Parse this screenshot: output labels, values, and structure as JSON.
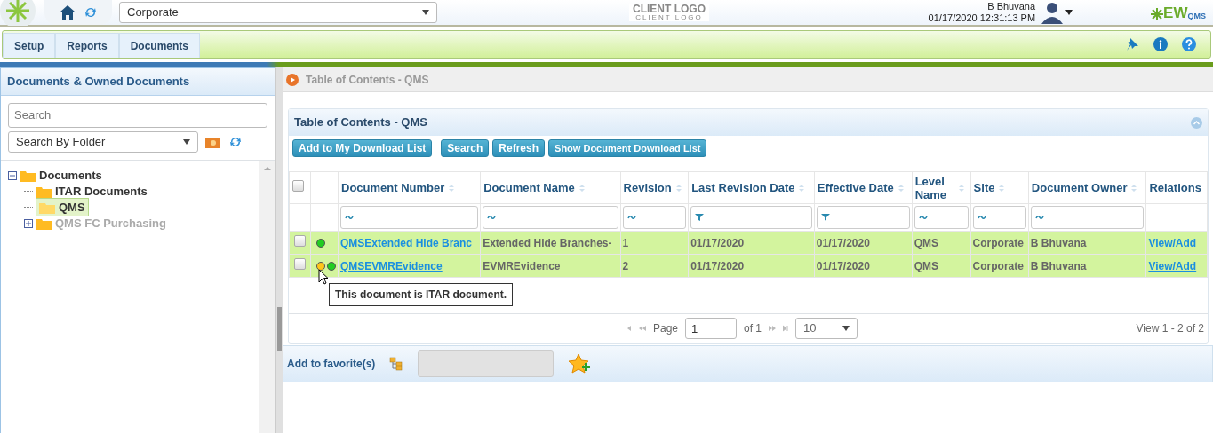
{
  "header": {
    "site_select": {
      "value": "Corporate"
    },
    "client_logo": {
      "title": "CLIENT LOGO",
      "subtitle": "CLIENT LOGO"
    },
    "user": {
      "name": "B Bhuvana",
      "datetime": "01/17/2020 12:31:13 PM"
    },
    "brand": {
      "name": "EW",
      "sub": "QMS"
    }
  },
  "menu": [
    {
      "label": "Setup"
    },
    {
      "label": "Reports"
    },
    {
      "label": "Documents"
    }
  ],
  "sidebar": {
    "title": "Documents & Owned Documents",
    "search": {
      "placeholder": "Search"
    },
    "folder_select": {
      "value": "Search By Folder"
    },
    "tree": [
      {
        "label": "Documents",
        "expanded": true,
        "selected": false,
        "disabled": false,
        "children": [
          {
            "label": "ITAR Documents",
            "selected": false,
            "disabled": false
          },
          {
            "label": "QMS",
            "selected": true,
            "disabled": false
          },
          {
            "label": "QMS FC Purchasing",
            "expanded": false,
            "selected": false,
            "disabled": true
          }
        ]
      }
    ]
  },
  "breadcrumb": [
    "Table of Contents - QMS"
  ],
  "panel": {
    "title": "Table of Contents - QMS",
    "buttons": [
      "Add to My Download List",
      "Search",
      "Refresh",
      "Show Document Download List"
    ],
    "table": {
      "select_all": {
        "checked": false
      },
      "columns": [
        {
          "label": "Document Number",
          "sortable": true,
          "kind": "text"
        },
        {
          "label": "Document Name",
          "sortable": true,
          "kind": "text"
        },
        {
          "label": "Revision",
          "sortable": true,
          "kind": "text"
        },
        {
          "label": "Last Revision Date",
          "sortable": true,
          "kind": "date"
        },
        {
          "label": "Effective Date",
          "sortable": true,
          "kind": "date"
        },
        {
          "label": "Level Name",
          "sortable": true,
          "kind": "text"
        },
        {
          "label": "Site",
          "sortable": true,
          "kind": "text"
        },
        {
          "label": "Document Owner",
          "sortable": true,
          "kind": "text"
        },
        {
          "label": "Relations",
          "sortable": false,
          "kind": "plain"
        }
      ],
      "rows": [
        {
          "checked": false,
          "status": [
            {
              "color": "#22cc22"
            }
          ],
          "cells": [
            "QMSExtended Hide Branc",
            "Extended Hide Branches-",
            "1",
            "01/17/2020",
            "01/17/2020",
            "QMS",
            "Corporate",
            "B Bhuvana",
            "View/Add"
          ]
        },
        {
          "checked": false,
          "status": [
            {
              "color": "#ffc61a"
            },
            {
              "color": "#22cc22"
            }
          ],
          "cells": [
            "QMSEVMREvidence",
            "EVMREvidence",
            "2",
            "01/17/2020",
            "01/17/2020",
            "QMS",
            "Corporate",
            "B Bhuvana",
            "View/Add"
          ]
        }
      ]
    },
    "tooltip": "This document is ITAR document.",
    "pager": {
      "page_label": "Page",
      "page": "1",
      "of": "of 1",
      "page_size": "10",
      "summary": "View 1 - 2 of 2"
    }
  },
  "favorites": {
    "label": "Add to favorite(s)"
  }
}
